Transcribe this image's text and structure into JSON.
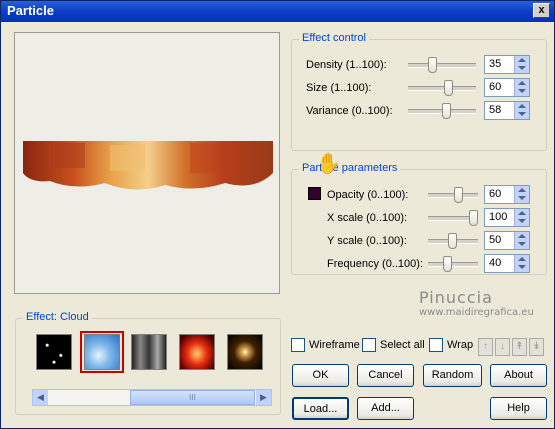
{
  "window": {
    "title": "Particle",
    "close_label": "x"
  },
  "effect_control": {
    "title": "Effect control",
    "rows": [
      {
        "label": "Density (1..100):",
        "value": "35"
      },
      {
        "label": "Size (1..100):",
        "value": "60"
      },
      {
        "label": "Variance (0..100):",
        "value": "58"
      }
    ]
  },
  "particle_parameters": {
    "title": "Particle parameters",
    "rows": [
      {
        "label": "Opacity (0..100):",
        "value": "60"
      },
      {
        "label": "X scale (0..100):",
        "value": "100"
      },
      {
        "label": "Y scale (0..100):",
        "value": "50"
      },
      {
        "label": "Frequency (0..100):",
        "value": "40"
      }
    ],
    "color": "#330033"
  },
  "effect_panel": {
    "title": "Effect: Cloud",
    "thumbs": [
      "stars",
      "cloud",
      "smoke",
      "fire",
      "sparkle"
    ],
    "selected": "cloud"
  },
  "options": {
    "wireframe": "Wireframe",
    "select_all": "Select all",
    "wrap": "Wrap"
  },
  "buttons": {
    "ok": "OK",
    "cancel": "Cancel",
    "random": "Random",
    "about": "About",
    "load": "Load...",
    "add": "Add...",
    "help": "Help"
  },
  "watermark": {
    "name": "Pinuccia",
    "url": "www.maidiregrafica.eu"
  },
  "colors": {
    "title_bar": "#0a3ec8",
    "group_title": "#0046d5",
    "selected_border": "#c80000"
  }
}
